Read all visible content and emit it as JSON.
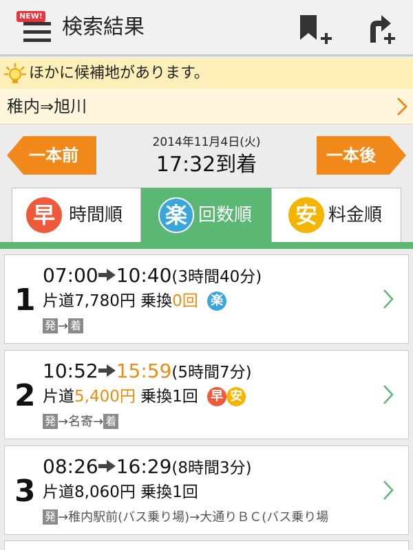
{
  "header": {
    "new_badge": "NEW!",
    "title": "検索結果",
    "icons": [
      "menu-icon",
      "bookmark-add-icon",
      "route-add-icon"
    ]
  },
  "notice": {
    "text": "ほかに候補地があります。",
    "icon": "bulb-icon"
  },
  "route": {
    "text": "稚内⇒旭川"
  },
  "timenav": {
    "prev_label": "一本前",
    "next_label": "一本後",
    "date": "2014年11月4日(火)",
    "arrival": "17:32到着"
  },
  "tabs": [
    {
      "badge": "早",
      "label": "時間順",
      "badge_color": "#ee5a3c",
      "active": false
    },
    {
      "badge": "楽",
      "label": "回数順",
      "badge_color": "#3aa6d9",
      "active": true
    },
    {
      "badge": "安",
      "label": "料金順",
      "badge_color": "#f4b400",
      "active": false
    }
  ],
  "results": [
    {
      "num": "1",
      "depart": "07:00",
      "arrive": "10:40",
      "duration": "(3時間40分)",
      "fare_prefix": "片道",
      "fare": "7,780円",
      "transfer_prefix": "乗換",
      "transfer": "0回",
      "badges": [
        "楽"
      ],
      "route_tags": [
        "発",
        "着"
      ],
      "route_text": ""
    },
    {
      "num": "2",
      "depart": "10:52",
      "arrive": "15:59",
      "duration": "(5時間7分)",
      "fare_prefix": "片道",
      "fare": "5,400円",
      "transfer_prefix": "乗換",
      "transfer": "1回",
      "badges": [
        "早",
        "安"
      ],
      "route_tags": [
        "発",
        "着"
      ],
      "route_text": "→名寄→"
    },
    {
      "num": "3",
      "depart": "08:26",
      "arrive": "16:29",
      "duration": "(8時間3分)",
      "fare_prefix": "片道",
      "fare": "8,060円",
      "transfer_prefix": "乗換",
      "transfer": "1回",
      "badges": [],
      "route_tags": [
        "発"
      ],
      "route_text": "→稚内駅前(バス乗り場)→大通りＢＣ(バス乗り場"
    }
  ],
  "colors": {
    "accent_green": "#5bb774",
    "accent_orange": "#f08a16",
    "notice_bg": "#fcefb7"
  }
}
